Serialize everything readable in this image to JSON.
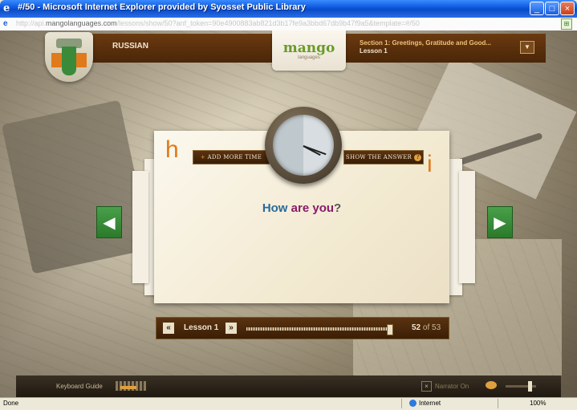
{
  "window": {
    "title": "#/50 - Microsoft Internet Explorer provided by Syosset Public Library",
    "url_prefix": "http://api.",
    "url_domain": "mangolanguages.com",
    "url_rest": "/lessons/show/50?anf_token=90e4900883ab821d3b17fe9a3bbd67db9b47f9a5&template=#/50"
  },
  "header": {
    "language": "RUSSIAN",
    "logo_text": "mango",
    "logo_sub": "languages",
    "section_title": "Section 1: Greetings, Gratitude and Good...",
    "section_lesson": "Lesson 1",
    "dropdown_icon": "chevron-down-icon"
  },
  "card": {
    "phrase_word1": "How",
    "phrase_word2": "are you",
    "phrase_punct": "?",
    "label_h": "h",
    "label_i": "i",
    "add_time": "ADD MORE TIME",
    "add_time_plus": "+",
    "show_answer": "SHOW THE ANSWER",
    "show_answer_q": "?"
  },
  "lesson_nav": {
    "prev": "«",
    "label": "Lesson 1",
    "next": "»",
    "current": "52",
    "of_text": "of 53",
    "progress": 0.98
  },
  "bottom": {
    "keyboard_guide": "Keyboard Guide",
    "narrator": "Narrator On",
    "narrator_box": "×"
  },
  "status": {
    "left": "Done",
    "zone": "Internet",
    "zoom": "100%"
  },
  "colors": {
    "accent_orange": "#e07a1a",
    "nav_green": "#3a8a3a",
    "word_blue": "#2a6a9a",
    "word_purple": "#8a1a6a"
  }
}
